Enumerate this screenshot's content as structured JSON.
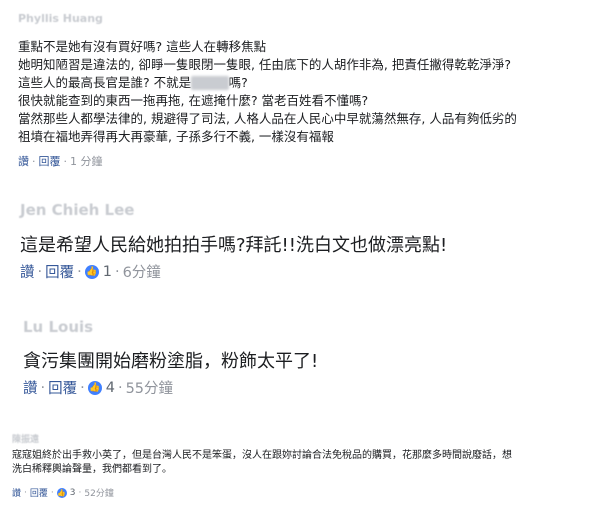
{
  "comments": [
    {
      "author": "Phyllis Huang",
      "lines": [
        "重點不是她有沒有買好嗎? 這些人在轉移焦點",
        "她明知陋習是違法的, 卻睜一隻眼閉一隻眼, 任由底下的人胡作非為, 把責任撇得乾乾淨淨?",
        "這些人的最高長官是誰? 不就是",
        "嗎?",
        "很快就能查到的東西一拖再拖, 在遮掩什麼? 當老百姓看不懂嗎?",
        "當然那些人都學法律的, 規避得了司法, 人格人品在人民心中早就蕩然無存, 人品有夠低劣的",
        "祖墳在福地弄得再大再豪華, 子孫多行不義, 一樣沒有福報"
      ],
      "like": "讚",
      "reply": "回覆",
      "time": "1 分鐘"
    },
    {
      "author": "Jen Chieh Lee",
      "lines": [
        "這是希望人民給她拍拍手嗎?拜託!!洗白文也做漂亮點!"
      ],
      "like": "讚",
      "reply": "回覆",
      "reactions": "1",
      "time": "6分鐘"
    },
    {
      "author": "Lu Louis",
      "lines": [
        "貪污集團開始磨粉塗脂，粉飾太平了!"
      ],
      "like": "讚",
      "reply": "回覆",
      "reactions": "4",
      "time": "55分鐘"
    },
    {
      "author": "陳振遠",
      "lines": [
        "寇寇姐終於出手救小英了，但是台灣人民不是笨蛋，沒人在跟妳討論合法免稅品的購買，花那麼多時間說廢話，想",
        "洗白稀釋輿論聲量，我們都看到了。"
      ],
      "like": "讚",
      "reply": "回覆",
      "reactions": "3",
      "time": "52分鐘"
    }
  ],
  "colors": {
    "link": "#365899",
    "meta": "#90949c",
    "like_badge": "#4080ff",
    "text": "#1c1e21"
  },
  "icons": {
    "like_badge": "thumbs-up-icon"
  }
}
